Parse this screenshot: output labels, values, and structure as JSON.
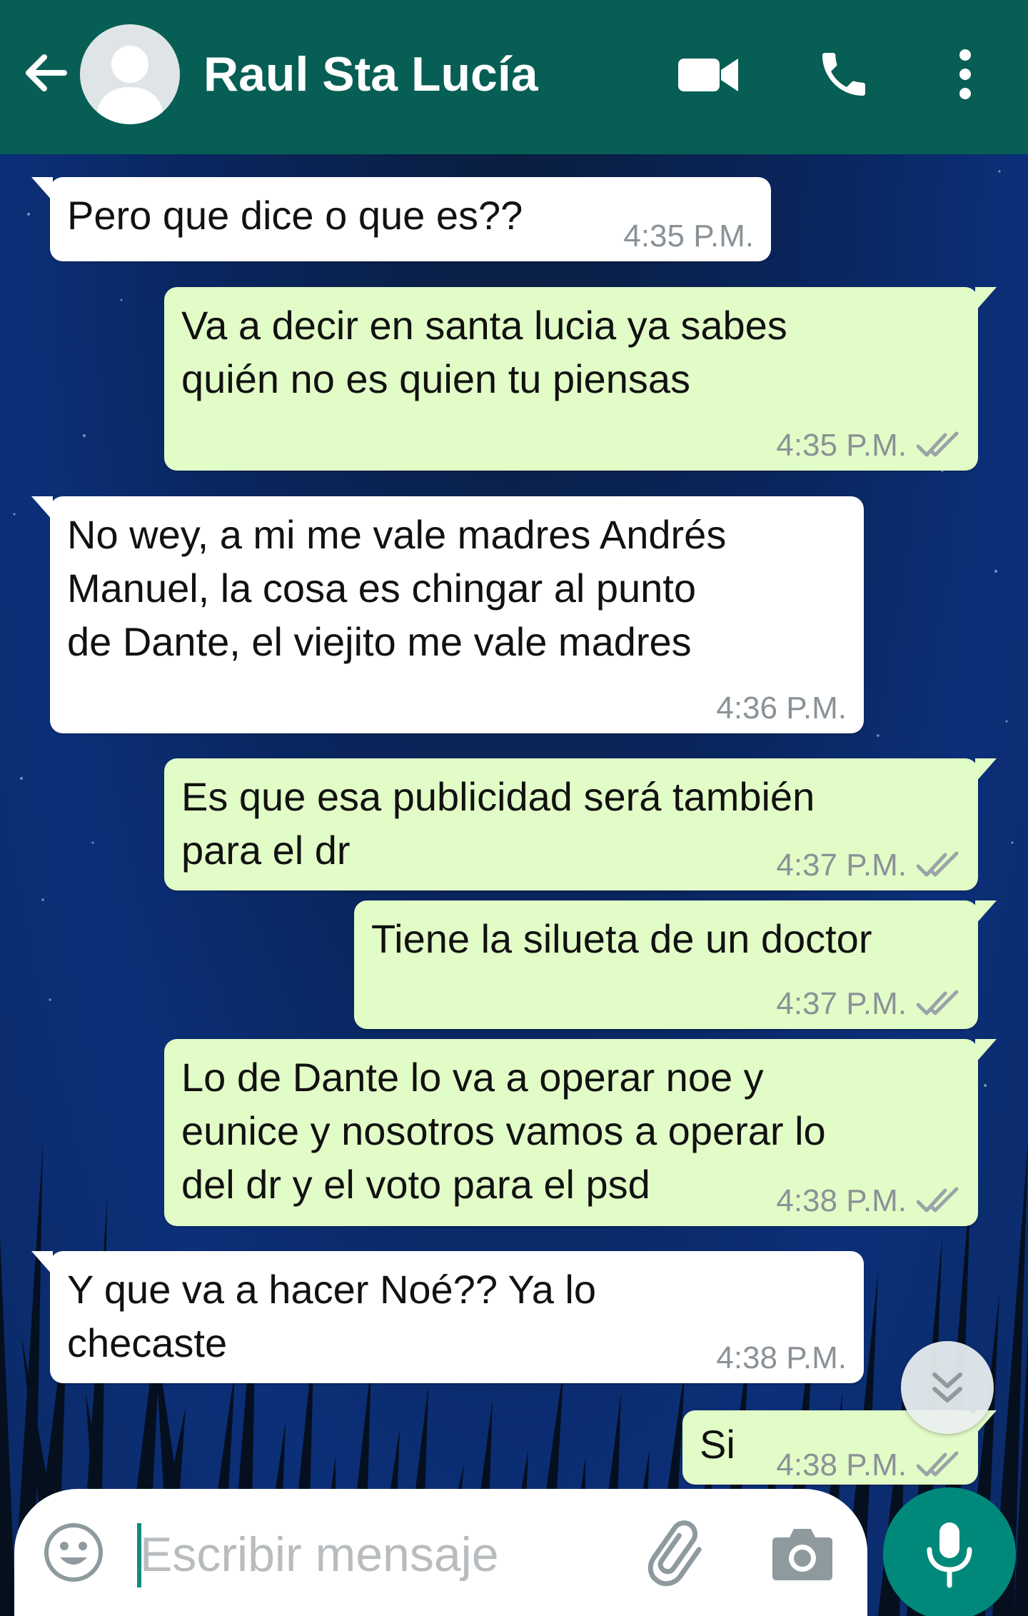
{
  "header": {
    "contact_name": "Raul Sta Lucía",
    "icons": [
      "back-arrow-icon",
      "avatar",
      "video-call-icon",
      "phone-icon",
      "more-options-icon"
    ],
    "color": "#075e54"
  },
  "messages": [
    {
      "direction": "incoming",
      "text": "Pero que dice o que es??",
      "time": "4:35 P.M."
    },
    {
      "direction": "outgoing",
      "text": "Va a decir en santa lucia ya sabes\nquién no es quien tu piensas",
      "time": "4:35 P.M.",
      "status": "delivered"
    },
    {
      "direction": "incoming",
      "text": "No wey, a mi me vale madres Andrés\nManuel, la cosa es chingar al punto\nde Dante, el viejito me vale madres",
      "time": "4:36 P.M."
    },
    {
      "direction": "outgoing",
      "text": "Es que esa publicidad será también\npara el dr",
      "time": "4:37 P.M.",
      "status": "delivered"
    },
    {
      "direction": "outgoing",
      "text": "Tiene la silueta de un doctor",
      "time": "4:37 P.M.",
      "status": "delivered"
    },
    {
      "direction": "outgoing",
      "text": "Lo de Dante lo va a operar noe y\neunice y nosotros vamos a operar lo\ndel dr y el voto para el psd",
      "time": "4:38 P.M.",
      "status": "delivered"
    },
    {
      "direction": "incoming",
      "text": "Y que va a hacer Noé?? Ya lo\nchecaste",
      "time": "4:38 P.M."
    },
    {
      "direction": "outgoing",
      "text": "Si",
      "time": "4:38 P.M.",
      "status": "delivered"
    }
  ],
  "composer": {
    "placeholder": "Escribir mensaje",
    "icons": [
      "emoji-icon",
      "attach-icon",
      "camera-icon",
      "mic-icon"
    ]
  },
  "colors": {
    "incoming_bubble": "#ffffff",
    "outgoing_bubble": "#e2fcc7",
    "accent": "#00897b"
  }
}
